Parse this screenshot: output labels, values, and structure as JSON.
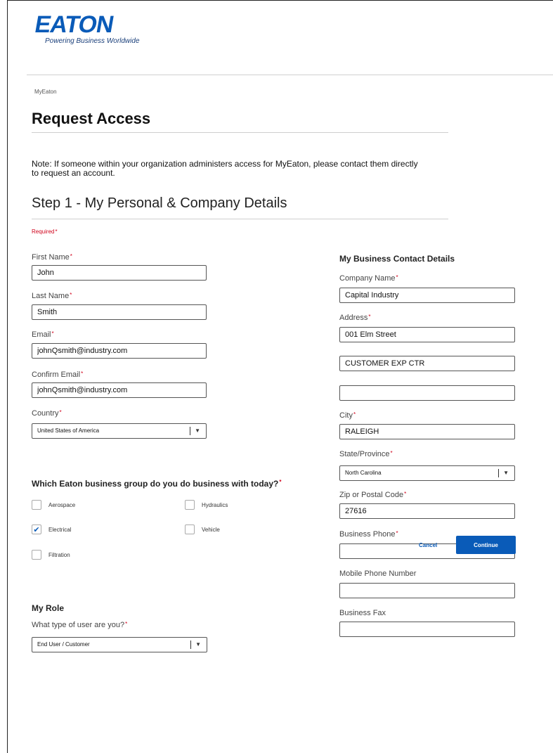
{
  "brand": {
    "logo_text": "EATON",
    "tagline": "Powering Business Worldwide",
    "color": "#0a5bb8"
  },
  "breadcrumb": "MyEaton",
  "page_title": "Request Access",
  "note": "Note: If someone within your organization administers access for MyEaton, please contact them directly to request an account.",
  "step_title": "Step 1 - My Personal & Company Details",
  "required_label": "Required",
  "required_mark": "*",
  "personal": {
    "first_name": {
      "label": "First Name",
      "value": "John"
    },
    "last_name": {
      "label": "Last Name",
      "value": "Smith"
    },
    "email": {
      "label": "Email",
      "value": "johnQsmith@industry.com"
    },
    "confirm_email": {
      "label": "Confirm Email",
      "value": "johnQsmith@industry.com"
    },
    "country": {
      "label": "Country",
      "value": "United States of America"
    }
  },
  "business_group": {
    "question": "Which Eaton business group do you do business with today?",
    "options": [
      {
        "label": "Aerospace",
        "checked": false
      },
      {
        "label": "Hydraulics",
        "checked": false
      },
      {
        "label": "Electrical",
        "checked": true
      },
      {
        "label": "Vehicle",
        "checked": false
      },
      {
        "label": "Filtration",
        "checked": false
      }
    ]
  },
  "role": {
    "heading": "My Role",
    "question": "What type of user are you?",
    "value": "End User / Customer"
  },
  "contact": {
    "heading": "My Business Contact Details",
    "company_name": {
      "label": "Company Name",
      "value": "Capital Industry"
    },
    "address": {
      "label": "Address",
      "line1": "001 Elm Street",
      "line2": "CUSTOMER EXP CTR",
      "line3": ""
    },
    "city": {
      "label": "City",
      "value": "RALEIGH"
    },
    "state": {
      "label": "State/Province",
      "value": "North Carolina"
    },
    "zip": {
      "label": "Zip or Postal Code",
      "value": "27616"
    },
    "business_phone": {
      "label": "Business Phone",
      "value": ""
    },
    "mobile_phone": {
      "label": "Mobile Phone Number",
      "value": ""
    },
    "business_fax": {
      "label": "Business Fax",
      "value": ""
    }
  },
  "actions": {
    "cancel": "Cancel",
    "continue": "Continue"
  }
}
